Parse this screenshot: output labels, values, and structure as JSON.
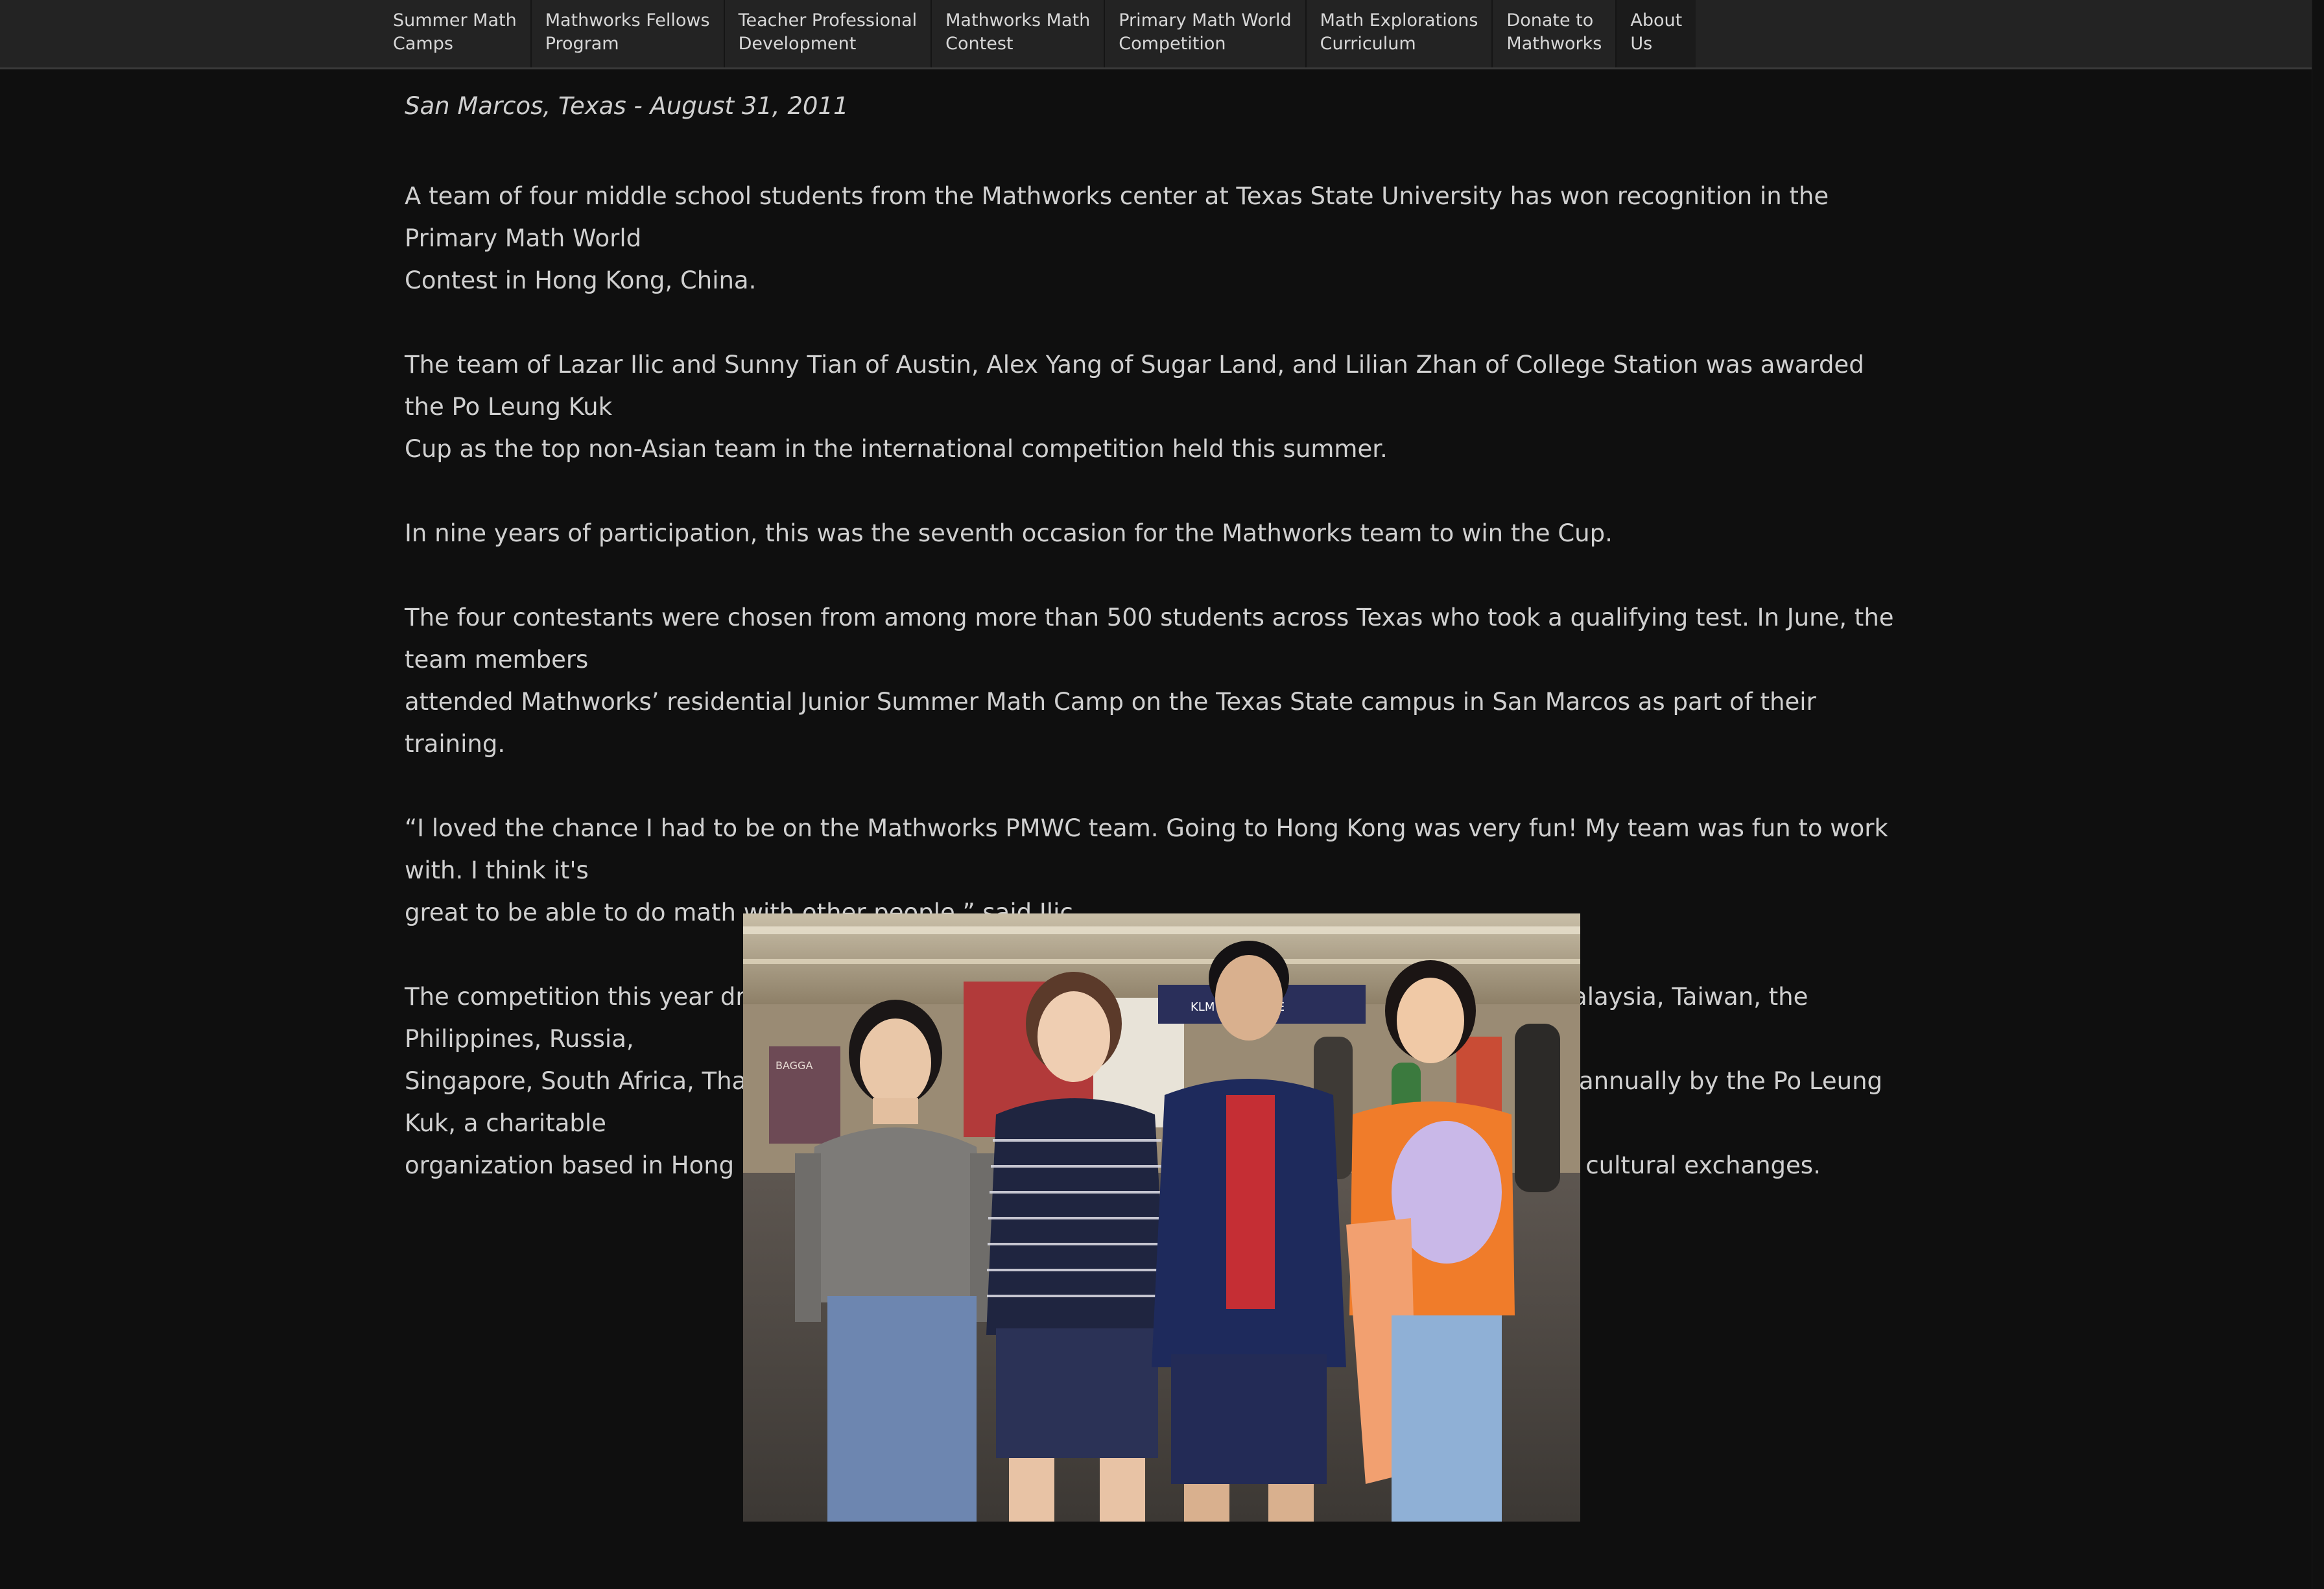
{
  "nav": {
    "items": [
      {
        "line1": "Summer Math",
        "line2": "Camps"
      },
      {
        "line1": "Mathworks Fellows",
        "line2": "Program"
      },
      {
        "line1": "Teacher Professional",
        "line2": "Development"
      },
      {
        "line1": "Mathworks Math",
        "line2": "Contest"
      },
      {
        "line1": "Primary Math World",
        "line2": "Competition"
      },
      {
        "line1": "Math Explorations",
        "line2": "Curriculum"
      },
      {
        "line1": "Donate to",
        "line2": "Mathworks"
      },
      {
        "line1": "About",
        "line2": "Us"
      }
    ]
  },
  "article": {
    "dateline": "San Marcos, Texas - August 31, 2011",
    "paragraphs": [
      "A team of four middle school students from the Mathworks center at Texas State University has won recognition in the Primary Math World\nContest in Hong Kong, China.",
      "The team of Lazar Ilic and Sunny Tian of Austin, Alex Yang of Sugar Land, and Lilian Zhan of College Station was awarded the Po Leung Kuk\nCup as the top non-Asian team in the international competition held this summer.",
      "In nine years of participation, this was the seventh occasion for the Mathworks team to win the Cup.",
      "The four contestants were chosen from among more than 500 students across Texas who took a qualifying test. In June, the team members\nattended Mathworks’ residential Junior Summer Math Camp on the Texas State campus in San Marcos as part of their training.",
      "“I loved the chance I had to be on the Mathworks PMWC team.  Going to Hong Kong was very fun!  My team was fun to work with.  I think it's\ngreat to be able to do math with other people,” said Ilic.",
      "The competition this year drew teams from Australia, Bulgaria, China, India, Indonesia, Macau, Malaysia, Taiwan, the Philippines, Russia,\nSingapore, South Africa, Thailand, the United States, and Hong Kong. The math contest is hosted annually by the Po Leung Kuk, a charitable\norganization based in Hong Kong, to encourage young students' interest in math while promoting cultural exchanges."
    ]
  },
  "photo": {
    "sign_text": "KLM AIRFRANCE",
    "side_sign_text": "BAGGA"
  },
  "colors": {
    "page_bg": "#0f0f0f",
    "nav_bg": "#232323",
    "text": "#d0d0d0"
  }
}
